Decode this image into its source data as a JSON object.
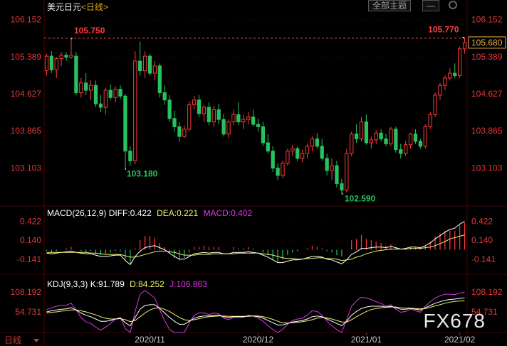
{
  "header": {
    "title": "美元日元",
    "period_link": "<日线>",
    "theme_button": "全部主题",
    "minimize": "—"
  },
  "colors": {
    "up": "#ff3b3b",
    "down": "#27c25f",
    "bg": "#000000",
    "grid": "#3a0000",
    "axis_text": "#e03838",
    "diff_line": "#ffffff",
    "dea_line": "#f0f070",
    "macd_label": "#d838e0",
    "kdj_k": "#ffffff",
    "kdj_d": "#f0f070",
    "kdj_j": "#d838e0"
  },
  "macd_header": {
    "name": "MACD(26,12,9)",
    "diff": "DIFF:0.422",
    "dea": "DEA:0.221",
    "macd": "MACD:0.402"
  },
  "kdj_header": {
    "name": "KDJ(9,3,3)",
    "k": "K:91.789",
    "d": "D:84.252",
    "j": "J:106.863"
  },
  "footer": {
    "period": "日线",
    "period_icon": "chevron-down-icon"
  },
  "watermark": "FX678",
  "chart_data": [
    {
      "type": "candlestick",
      "price_ticks": [
        "106.152",
        "105.389",
        "104.627",
        "103.865",
        "103.103"
      ],
      "ylim": [
        102.35,
        106.35
      ],
      "x_ticks": [
        "2020/11",
        "2020/12",
        "2021/01",
        "2021/02"
      ],
      "current_price": "105.680",
      "annotations": {
        "high_left": "105.750",
        "low_left": "103.180",
        "low_right": "102.590",
        "high_right": "105.770"
      },
      "ohlc": [
        [
          105.1,
          105.45,
          105.0,
          105.4
        ],
        [
          105.4,
          105.5,
          105.05,
          105.12
        ],
        [
          105.12,
          105.38,
          104.95,
          105.35
        ],
        [
          105.35,
          105.48,
          105.2,
          105.42
        ],
        [
          105.42,
          105.48,
          105.3,
          105.38
        ],
        [
          105.38,
          105.75,
          105.35,
          105.42
        ],
        [
          105.4,
          105.48,
          104.6,
          104.65
        ],
        [
          104.65,
          104.95,
          104.55,
          104.85
        ],
        [
          104.85,
          105.05,
          104.6,
          104.7
        ],
        [
          104.7,
          104.9,
          104.5,
          104.8
        ],
        [
          104.8,
          104.9,
          104.35,
          104.42
        ],
        [
          104.42,
          104.6,
          104.25,
          104.35
        ],
        [
          104.35,
          104.75,
          104.2,
          104.7
        ],
        [
          104.7,
          104.82,
          104.5,
          104.55
        ],
        [
          104.55,
          104.78,
          104.45,
          104.72
        ],
        [
          104.72,
          104.8,
          104.52,
          104.58
        ],
        [
          104.58,
          104.62,
          103.1,
          103.45
        ],
        [
          103.45,
          103.55,
          103.15,
          103.25
        ],
        [
          103.25,
          105.5,
          103.18,
          105.3
        ],
        [
          105.3,
          105.7,
          105.0,
          105.1
        ],
        [
          105.1,
          105.5,
          104.95,
          105.4
        ],
        [
          105.4,
          105.45,
          105.0,
          105.05
        ],
        [
          105.05,
          105.3,
          104.9,
          105.2
        ],
        [
          105.2,
          105.25,
          104.55,
          104.65
        ],
        [
          104.65,
          104.8,
          104.4,
          104.5
        ],
        [
          104.5,
          104.6,
          104.05,
          104.12
        ],
        [
          104.12,
          104.28,
          103.85,
          103.95
        ],
        [
          103.95,
          104.05,
          103.65,
          103.75
        ],
        [
          103.75,
          103.98,
          103.72,
          103.9
        ],
        [
          103.9,
          104.48,
          103.85,
          104.4
        ],
        [
          104.4,
          104.58,
          104.3,
          104.5
        ],
        [
          104.5,
          104.6,
          104.15,
          104.22
        ],
        [
          104.22,
          104.4,
          104.05,
          104.35
        ],
        [
          104.35,
          104.45,
          103.98,
          104.05
        ],
        [
          104.05,
          104.38,
          103.95,
          104.3
        ],
        [
          104.3,
          104.42,
          104.0,
          104.1
        ],
        [
          104.1,
          104.22,
          103.75,
          103.8
        ],
        [
          103.8,
          104.1,
          103.72,
          104.05
        ],
        [
          104.05,
          104.3,
          103.98,
          104.2
        ],
        [
          104.2,
          104.45,
          103.98,
          104.05
        ],
        [
          104.05,
          104.2,
          103.9,
          104.1
        ],
        [
          104.1,
          104.25,
          104.0,
          104.15
        ],
        [
          104.15,
          104.3,
          103.95,
          104.0
        ],
        [
          104.0,
          104.12,
          103.85,
          103.95
        ],
        [
          103.95,
          104.05,
          103.55,
          103.62
        ],
        [
          103.62,
          103.8,
          103.4,
          103.45
        ],
        [
          103.45,
          103.55,
          103.02,
          103.1
        ],
        [
          103.1,
          103.2,
          102.85,
          102.95
        ],
        [
          102.95,
          103.25,
          102.9,
          103.2
        ],
        [
          103.2,
          103.5,
          103.15,
          103.45
        ],
        [
          103.45,
          103.58,
          103.35,
          103.5
        ],
        [
          103.5,
          103.55,
          103.25,
          103.3
        ],
        [
          103.3,
          103.48,
          103.22,
          103.4
        ],
        [
          103.4,
          103.6,
          103.3,
          103.55
        ],
        [
          103.55,
          103.75,
          103.45,
          103.7
        ],
        [
          103.7,
          103.82,
          103.5,
          103.55
        ],
        [
          103.55,
          103.7,
          103.25,
          103.3
        ],
        [
          103.3,
          103.4,
          102.95,
          103.05
        ],
        [
          103.05,
          103.3,
          102.85,
          103.15
        ],
        [
          103.15,
          103.25,
          102.7,
          102.78
        ],
        [
          102.78,
          102.88,
          102.59,
          102.65
        ],
        [
          102.65,
          103.5,
          102.6,
          103.4
        ],
        [
          103.4,
          103.85,
          103.35,
          103.8
        ],
        [
          103.8,
          104.0,
          103.62,
          103.7
        ],
        [
          103.7,
          104.15,
          103.65,
          104.05
        ],
        [
          104.05,
          104.2,
          103.58,
          103.62
        ],
        [
          103.62,
          103.75,
          103.5,
          103.68
        ],
        [
          103.68,
          103.88,
          103.6,
          103.82
        ],
        [
          103.82,
          103.9,
          103.65,
          103.7
        ],
        [
          103.7,
          103.8,
          103.55,
          103.6
        ],
        [
          103.6,
          103.95,
          103.55,
          103.9
        ],
        [
          103.9,
          103.95,
          103.42,
          103.48
        ],
        [
          103.48,
          103.6,
          103.3,
          103.4
        ],
        [
          103.4,
          103.65,
          103.35,
          103.58
        ],
        [
          103.58,
          103.82,
          103.5,
          103.8
        ],
        [
          103.8,
          103.9,
          103.6,
          103.65
        ],
        [
          103.65,
          103.7,
          103.5,
          103.55
        ],
        [
          103.55,
          104.0,
          103.5,
          103.95
        ],
        [
          103.95,
          104.25,
          103.9,
          104.2
        ],
        [
          104.2,
          104.65,
          104.15,
          104.6
        ],
        [
          104.6,
          104.85,
          104.5,
          104.8
        ],
        [
          104.8,
          105.0,
          104.7,
          104.95
        ],
        [
          104.95,
          105.15,
          104.9,
          105.05
        ],
        [
          105.05,
          105.25,
          104.95,
          105.0
        ],
        [
          105.0,
          105.6,
          104.95,
          105.55
        ],
        [
          105.55,
          105.77,
          105.45,
          105.68
        ]
      ]
    },
    {
      "type": "macd",
      "ticks": [
        "0.422",
        "0.140",
        "-0.141"
      ],
      "ylim": [
        -0.3,
        0.5
      ],
      "diff": [
        -0.05,
        -0.06,
        -0.05,
        -0.04,
        -0.03,
        -0.02,
        -0.04,
        -0.05,
        -0.06,
        -0.06,
        -0.08,
        -0.1,
        -0.1,
        -0.09,
        -0.08,
        -0.08,
        -0.16,
        -0.22,
        -0.1,
        -0.02,
        0.03,
        0.05,
        0.06,
        0.03,
        0.0,
        -0.05,
        -0.1,
        -0.14,
        -0.14,
        -0.1,
        -0.06,
        -0.05,
        -0.04,
        -0.05,
        -0.04,
        -0.04,
        -0.06,
        -0.06,
        -0.04,
        -0.04,
        -0.04,
        -0.03,
        -0.04,
        -0.05,
        -0.08,
        -0.11,
        -0.15,
        -0.19,
        -0.19,
        -0.17,
        -0.15,
        -0.15,
        -0.14,
        -0.12,
        -0.1,
        -0.1,
        -0.11,
        -0.14,
        -0.15,
        -0.18,
        -0.21,
        -0.15,
        -0.07,
        -0.03,
        0.02,
        0.02,
        0.03,
        0.04,
        0.04,
        0.03,
        0.05,
        0.03,
        0.01,
        0.02,
        0.04,
        0.04,
        0.03,
        0.06,
        0.1,
        0.16,
        0.21,
        0.26,
        0.3,
        0.32,
        0.38,
        0.42
      ],
      "dea": [
        -0.04,
        -0.04,
        -0.04,
        -0.04,
        -0.04,
        -0.04,
        -0.04,
        -0.04,
        -0.04,
        -0.05,
        -0.05,
        -0.06,
        -0.07,
        -0.07,
        -0.07,
        -0.07,
        -0.09,
        -0.11,
        -0.11,
        -0.09,
        -0.07,
        -0.05,
        -0.03,
        -0.02,
        -0.02,
        -0.03,
        -0.04,
        -0.06,
        -0.08,
        -0.08,
        -0.08,
        -0.07,
        -0.07,
        -0.07,
        -0.06,
        -0.06,
        -0.06,
        -0.06,
        -0.06,
        -0.05,
        -0.05,
        -0.05,
        -0.05,
        -0.05,
        -0.06,
        -0.07,
        -0.08,
        -0.1,
        -0.12,
        -0.13,
        -0.13,
        -0.14,
        -0.14,
        -0.13,
        -0.13,
        -0.12,
        -0.12,
        -0.13,
        -0.13,
        -0.14,
        -0.16,
        -0.15,
        -0.14,
        -0.11,
        -0.09,
        -0.06,
        -0.04,
        -0.02,
        -0.01,
        0.0,
        0.01,
        0.01,
        0.01,
        0.01,
        0.02,
        0.02,
        0.02,
        0.03,
        0.04,
        0.06,
        0.09,
        0.12,
        0.16,
        0.18,
        0.2,
        0.22
      ],
      "macd": [
        -0.02,
        -0.04,
        -0.02,
        0.0,
        0.02,
        0.04,
        0.0,
        -0.02,
        -0.04,
        -0.02,
        -0.06,
        -0.08,
        -0.06,
        -0.04,
        -0.02,
        -0.02,
        -0.14,
        -0.22,
        0.02,
        0.14,
        0.2,
        0.2,
        0.18,
        0.1,
        0.04,
        -0.04,
        -0.12,
        -0.16,
        -0.12,
        -0.04,
        0.04,
        0.04,
        0.06,
        0.04,
        0.04,
        0.04,
        0.0,
        0.0,
        0.04,
        0.02,
        0.02,
        0.04,
        0.02,
        0.0,
        -0.04,
        -0.08,
        -0.14,
        -0.18,
        -0.14,
        -0.08,
        -0.04,
        -0.02,
        0.0,
        0.02,
        0.06,
        0.04,
        0.02,
        -0.02,
        -0.04,
        -0.08,
        -0.1,
        0.0,
        0.14,
        0.16,
        0.22,
        0.16,
        0.14,
        0.12,
        0.1,
        0.06,
        0.08,
        0.04,
        0.0,
        0.02,
        0.04,
        0.04,
        0.02,
        0.06,
        0.12,
        0.2,
        0.24,
        0.28,
        0.28,
        0.28,
        0.36,
        0.4
      ]
    },
    {
      "type": "kdj",
      "ticks": [
        "108.192",
        "54.731"
      ],
      "ylim": [
        0,
        125
      ],
      "k": [
        55,
        58,
        60,
        62,
        63,
        66,
        60,
        52,
        46,
        42,
        36,
        30,
        30,
        32,
        36,
        38,
        26,
        18,
        40,
        62,
        72,
        74,
        74,
        64,
        52,
        40,
        30,
        22,
        22,
        30,
        38,
        42,
        44,
        44,
        46,
        46,
        42,
        40,
        42,
        42,
        42,
        44,
        44,
        42,
        38,
        32,
        26,
        20,
        20,
        24,
        28,
        30,
        32,
        36,
        42,
        44,
        42,
        36,
        30,
        24,
        18,
        30,
        46,
        56,
        64,
        68,
        70,
        70,
        70,
        68,
        70,
        66,
        62,
        62,
        64,
        62,
        60,
        66,
        72,
        78,
        82,
        86,
        88,
        89,
        91,
        92
      ],
      "d": [
        52,
        54,
        55,
        57,
        58,
        60,
        60,
        58,
        55,
        51,
        47,
        42,
        38,
        36,
        36,
        37,
        34,
        29,
        32,
        42,
        52,
        60,
        65,
        66,
        62,
        56,
        48,
        40,
        34,
        32,
        34,
        37,
        40,
        42,
        43,
        44,
        44,
        43,
        43,
        43,
        43,
        43,
        44,
        44,
        42,
        39,
        35,
        30,
        26,
        25,
        26,
        27,
        29,
        31,
        34,
        38,
        40,
        39,
        36,
        32,
        28,
        28,
        34,
        42,
        49,
        56,
        61,
        64,
        66,
        67,
        68,
        68,
        66,
        65,
        65,
        64,
        63,
        64,
        67,
        71,
        74,
        78,
        81,
        83,
        84,
        84
      ],
      "j": [
        61,
        66,
        70,
        72,
        73,
        78,
        60,
        40,
        28,
        24,
        14,
        6,
        14,
        24,
        36,
        40,
        10,
        0,
        56,
        102,
        112,
        102,
        92,
        60,
        32,
        8,
        0,
        0,
        0,
        26,
        46,
        52,
        52,
        48,
        52,
        50,
        38,
        34,
        40,
        40,
        40,
        46,
        44,
        38,
        30,
        18,
        8,
        0,
        8,
        22,
        32,
        36,
        38,
        46,
        58,
        56,
        46,
        30,
        18,
        8,
        0,
        34,
        70,
        84,
        94,
        92,
        88,
        82,
        78,
        70,
        74,
        62,
        54,
        56,
        62,
        58,
        54,
        70,
        82,
        92,
        98,
        102,
        102,
        101,
        105,
        107
      ]
    }
  ]
}
